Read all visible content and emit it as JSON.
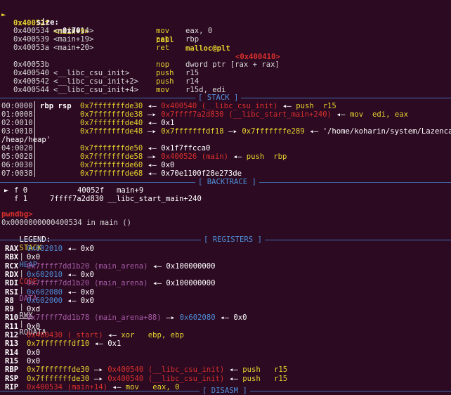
{
  "top": {
    "cur_addr": "0x40052f",
    "cur_sym": "<main+9>",
    "cur_mnem": "call",
    "cur_target": "malloc@plt",
    "cur_target_addr": "<0x400410>",
    "size_label": "size:",
    "size_value": "0x70"
  },
  "disasm": [
    {
      "addr": "0x400534",
      "sym": "<main+14>",
      "mnem": "mov",
      "ops": "eax, 0"
    },
    {
      "addr": "0x400539",
      "sym": "<main+19>",
      "mnem": "pop",
      "ops": "rbp"
    },
    {
      "addr": "0x40053a",
      "sym": "<main+20>",
      "mnem": "ret",
      "ops": ""
    },
    {
      "addr": "0x40053b",
      "sym": "",
      "mnem": "nop",
      "ops": "dword ptr [rax + rax]"
    },
    {
      "addr": "0x400540",
      "sym": "<__libc_csu_init>",
      "mnem": "push",
      "ops": "r15"
    },
    {
      "addr": "0x400542",
      "sym": "<__libc_csu_init+2>",
      "mnem": "push",
      "ops": "r14"
    },
    {
      "addr": "0x400544",
      "sym": "<__libc_csu_init+4>",
      "mnem": "mov",
      "ops": "r15d, edi"
    }
  ],
  "sections": {
    "stack": "[ STACK ]",
    "backtrace": "[ BACKTRACE ]",
    "registers": "[ REGISTERS ]",
    "disasm": "[ DISASM ]"
  },
  "stack": {
    "rbp_rsp": "rbp rsp",
    "rows": [
      {
        "off": "00:0000",
        "addr": "0x7fffffffde30",
        "arrow": "◂—",
        "v1": "0x400540",
        "v1_sym": "(__libc_csu_init)",
        "arrow2": "◂—",
        "ins": "push",
        "ops": "r15"
      },
      {
        "off": "01:0008",
        "addr": "0x7fffffffde38",
        "arrow": "—▸",
        "v1": "0x7ffff7a2d830",
        "v1_sym": "(__libc_start_main+240)",
        "arrow2": "◂—",
        "ins": "mov",
        "ops": "edi, eax"
      },
      {
        "off": "02:0010",
        "addr": "0x7fffffffde40",
        "arrow": "◂—",
        "v1": "0x1"
      },
      {
        "off": "03:0018",
        "addr": "0x7fffffffde48",
        "arrow": "—▸",
        "v1": "0x7fffffffdf18",
        "arrow2": "—▸",
        "v2": "0x7fffffffe289",
        "arrow3": "◂—",
        "str": "'/home/koharin/system/Lazenca"
      },
      {
        "off": "",
        "wrap": "/heap/heap'"
      },
      {
        "off": "04:0020",
        "addr": "0x7fffffffde50",
        "arrow": "◂—",
        "v1": "0x1f7ffcca0"
      },
      {
        "off": "05:0028",
        "addr": "0x7fffffffde58",
        "arrow": "—▸",
        "v1": "0x400526",
        "v1_sym": "(main)",
        "arrow2": "◂—",
        "ins": "push",
        "ops": "rbp"
      },
      {
        "off": "06:0030",
        "addr": "0x7fffffffde60",
        "arrow": "◂—",
        "v1": "0x0"
      },
      {
        "off": "07:0038",
        "addr": "0x7fffffffde68",
        "arrow": "◂—",
        "v1": "0x70e1100f28e273de"
      }
    ]
  },
  "backtrace": [
    {
      "marker": "►",
      "frame": "f 0",
      "addr": "40052f",
      "sym": "main+9"
    },
    {
      "marker": "",
      "frame": "f 1",
      "addr": "7ffff7a2d830",
      "sym": "__libc_start_main+240"
    }
  ],
  "prompt": {
    "name": "pwndbg>",
    "loc": "0x0000000000400534 in main ()",
    "legend_label": "LEGEND:",
    "legend": [
      "STACK",
      "HEAP",
      "CODE",
      "DATA",
      "RWX",
      "RODATA"
    ],
    "legend_sep": "|"
  },
  "registers": [
    {
      "name": "RAX",
      "v1": "0x602010",
      "v1_c": "blue",
      "a1": "◂—",
      "v2": "0x0"
    },
    {
      "name": "RBX",
      "v1": "0x0",
      "v1_c": "plain"
    },
    {
      "name": "RCX",
      "v1": "0x7ffff7dd1b20",
      "v1_c": "purple",
      "sym": "(main_arena)",
      "a1": "◂—",
      "v2": "0x100000000"
    },
    {
      "name": "RDX",
      "v1": "0x602010",
      "v1_c": "blue",
      "a1": "◂—",
      "v2": "0x0"
    },
    {
      "name": "RDI",
      "v1": "0x7ffff7dd1b20",
      "v1_c": "purple",
      "sym": "(main_arena)",
      "a1": "◂—",
      "v2": "0x100000000"
    },
    {
      "name": "RSI",
      "v1": "0x602080",
      "v1_c": "blue",
      "a1": "◂—",
      "v2": "0x0"
    },
    {
      "name": "R8",
      "v1": "0x602000",
      "v1_c": "blue",
      "a1": "◂—",
      "v2": "0x0"
    },
    {
      "name": "R9",
      "v1": "0xd",
      "v1_c": "plain"
    },
    {
      "name": "R10",
      "v1": "0x7ffff7dd1b78",
      "v1_c": "purple",
      "sym": "(main_arena+88)",
      "a1": "—▸",
      "v2": "0x602080",
      "v2_c": "blue",
      "a2": "◂—",
      "v3": "0x0"
    },
    {
      "name": "R11",
      "v1": "0x0",
      "v1_c": "plain"
    },
    {
      "name": "R12",
      "v1": "0x400430",
      "v1_c": "red",
      "sym": "(_start)",
      "a1": "◂—",
      "ins": "xor",
      "ops": "ebp, ebp"
    },
    {
      "name": "R13",
      "v1": "0x7fffffffdf10",
      "v1_c": "yellow",
      "a1": "◂—",
      "v2": "0x1"
    },
    {
      "name": "R14",
      "v1": "0x0",
      "v1_c": "plain"
    },
    {
      "name": "R15",
      "v1": "0x0",
      "v1_c": "plain"
    },
    {
      "name": "RBP",
      "v1": "0x7fffffffde30",
      "v1_c": "yellow",
      "a1": "—▸",
      "v2": "0x400540",
      "v2_c": "red",
      "sym2": "(__libc_csu_init)",
      "a2": "◂—",
      "ins": "push",
      "ops": "r15"
    },
    {
      "name": "RSP",
      "v1": "0x7fffffffde30",
      "v1_c": "yellow",
      "a1": "—▸",
      "v2": "0x400540",
      "v2_c": "red",
      "sym2": "(__libc_csu_init)",
      "a2": "◂—",
      "ins": "push",
      "ops": "r15"
    },
    {
      "name": "RIP",
      "v1": "0x400534",
      "v1_c": "red",
      "sym": "(main+14)",
      "a1": "◂—",
      "ins": "mov",
      "ops": "eax, 0"
    }
  ],
  "colors": {
    "background": "#2c0a22",
    "yellow": "#e5d22e",
    "red": "#d8302c",
    "blue": "#4e8ed8",
    "purple": "#a55aa5"
  }
}
